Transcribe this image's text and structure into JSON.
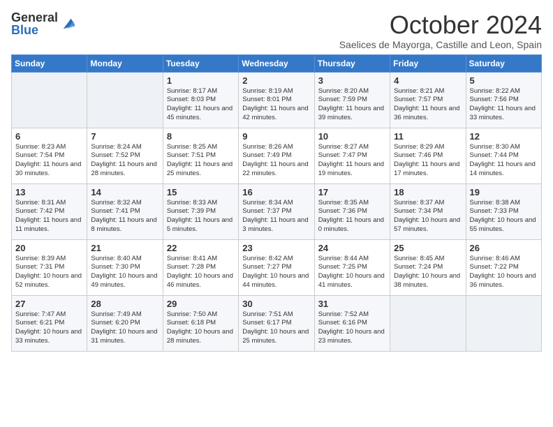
{
  "header": {
    "logo_general": "General",
    "logo_blue": "Blue",
    "month_title": "October 2024",
    "subtitle": "Saelices de Mayorga, Castille and Leon, Spain"
  },
  "days_of_week": [
    "Sunday",
    "Monday",
    "Tuesday",
    "Wednesday",
    "Thursday",
    "Friday",
    "Saturday"
  ],
  "weeks": [
    [
      {
        "day": "",
        "content": ""
      },
      {
        "day": "",
        "content": ""
      },
      {
        "day": "1",
        "content": "Sunrise: 8:17 AM\nSunset: 8:03 PM\nDaylight: 11 hours and 45 minutes."
      },
      {
        "day": "2",
        "content": "Sunrise: 8:19 AM\nSunset: 8:01 PM\nDaylight: 11 hours and 42 minutes."
      },
      {
        "day": "3",
        "content": "Sunrise: 8:20 AM\nSunset: 7:59 PM\nDaylight: 11 hours and 39 minutes."
      },
      {
        "day": "4",
        "content": "Sunrise: 8:21 AM\nSunset: 7:57 PM\nDaylight: 11 hours and 36 minutes."
      },
      {
        "day": "5",
        "content": "Sunrise: 8:22 AM\nSunset: 7:56 PM\nDaylight: 11 hours and 33 minutes."
      }
    ],
    [
      {
        "day": "6",
        "content": "Sunrise: 8:23 AM\nSunset: 7:54 PM\nDaylight: 11 hours and 30 minutes."
      },
      {
        "day": "7",
        "content": "Sunrise: 8:24 AM\nSunset: 7:52 PM\nDaylight: 11 hours and 28 minutes."
      },
      {
        "day": "8",
        "content": "Sunrise: 8:25 AM\nSunset: 7:51 PM\nDaylight: 11 hours and 25 minutes."
      },
      {
        "day": "9",
        "content": "Sunrise: 8:26 AM\nSunset: 7:49 PM\nDaylight: 11 hours and 22 minutes."
      },
      {
        "day": "10",
        "content": "Sunrise: 8:27 AM\nSunset: 7:47 PM\nDaylight: 11 hours and 19 minutes."
      },
      {
        "day": "11",
        "content": "Sunrise: 8:29 AM\nSunset: 7:46 PM\nDaylight: 11 hours and 17 minutes."
      },
      {
        "day": "12",
        "content": "Sunrise: 8:30 AM\nSunset: 7:44 PM\nDaylight: 11 hours and 14 minutes."
      }
    ],
    [
      {
        "day": "13",
        "content": "Sunrise: 8:31 AM\nSunset: 7:42 PM\nDaylight: 11 hours and 11 minutes."
      },
      {
        "day": "14",
        "content": "Sunrise: 8:32 AM\nSunset: 7:41 PM\nDaylight: 11 hours and 8 minutes."
      },
      {
        "day": "15",
        "content": "Sunrise: 8:33 AM\nSunset: 7:39 PM\nDaylight: 11 hours and 5 minutes."
      },
      {
        "day": "16",
        "content": "Sunrise: 8:34 AM\nSunset: 7:37 PM\nDaylight: 11 hours and 3 minutes."
      },
      {
        "day": "17",
        "content": "Sunrise: 8:35 AM\nSunset: 7:36 PM\nDaylight: 11 hours and 0 minutes."
      },
      {
        "day": "18",
        "content": "Sunrise: 8:37 AM\nSunset: 7:34 PM\nDaylight: 10 hours and 57 minutes."
      },
      {
        "day": "19",
        "content": "Sunrise: 8:38 AM\nSunset: 7:33 PM\nDaylight: 10 hours and 55 minutes."
      }
    ],
    [
      {
        "day": "20",
        "content": "Sunrise: 8:39 AM\nSunset: 7:31 PM\nDaylight: 10 hours and 52 minutes."
      },
      {
        "day": "21",
        "content": "Sunrise: 8:40 AM\nSunset: 7:30 PM\nDaylight: 10 hours and 49 minutes."
      },
      {
        "day": "22",
        "content": "Sunrise: 8:41 AM\nSunset: 7:28 PM\nDaylight: 10 hours and 46 minutes."
      },
      {
        "day": "23",
        "content": "Sunrise: 8:42 AM\nSunset: 7:27 PM\nDaylight: 10 hours and 44 minutes."
      },
      {
        "day": "24",
        "content": "Sunrise: 8:44 AM\nSunset: 7:25 PM\nDaylight: 10 hours and 41 minutes."
      },
      {
        "day": "25",
        "content": "Sunrise: 8:45 AM\nSunset: 7:24 PM\nDaylight: 10 hours and 38 minutes."
      },
      {
        "day": "26",
        "content": "Sunrise: 8:46 AM\nSunset: 7:22 PM\nDaylight: 10 hours and 36 minutes."
      }
    ],
    [
      {
        "day": "27",
        "content": "Sunrise: 7:47 AM\nSunset: 6:21 PM\nDaylight: 10 hours and 33 minutes."
      },
      {
        "day": "28",
        "content": "Sunrise: 7:49 AM\nSunset: 6:20 PM\nDaylight: 10 hours and 31 minutes."
      },
      {
        "day": "29",
        "content": "Sunrise: 7:50 AM\nSunset: 6:18 PM\nDaylight: 10 hours and 28 minutes."
      },
      {
        "day": "30",
        "content": "Sunrise: 7:51 AM\nSunset: 6:17 PM\nDaylight: 10 hours and 25 minutes."
      },
      {
        "day": "31",
        "content": "Sunrise: 7:52 AM\nSunset: 6:16 PM\nDaylight: 10 hours and 23 minutes."
      },
      {
        "day": "",
        "content": ""
      },
      {
        "day": "",
        "content": ""
      }
    ]
  ]
}
